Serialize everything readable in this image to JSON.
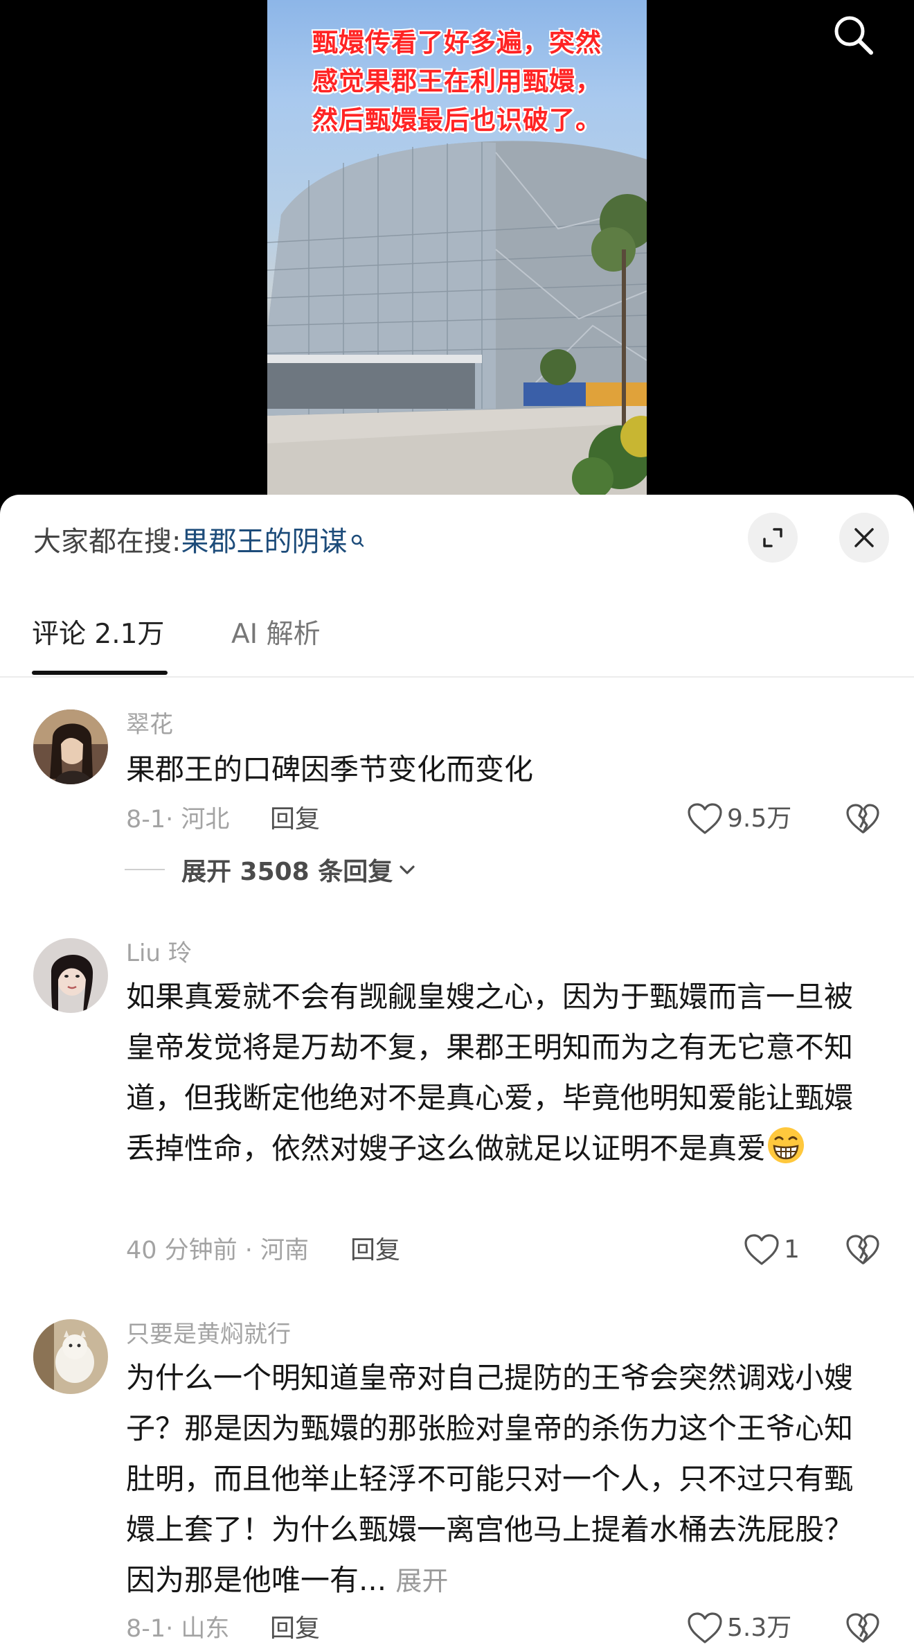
{
  "video": {
    "caption_lines": [
      "甄嬛传看了好多遍，突然",
      "感觉果郡王在利用甄嬛，",
      "然后甄嬛最后也识破了。"
    ]
  },
  "search_bar": {
    "prefix": "大家都在搜:",
    "term": "果郡王的阴谋"
  },
  "tabs": [
    {
      "label": "评论 2.1万",
      "active": true
    },
    {
      "label": "AI 解析",
      "active": false
    }
  ],
  "comments": [
    {
      "author": "翠花",
      "text": "果郡王的口碑因季节变化而变化",
      "meta": "8-1· 河北",
      "reply_label": "回复",
      "likes": "9.5万",
      "expand_replies": "展开 3508 条回复"
    },
    {
      "author": "Liu 玲",
      "text": "如果真爱就不会有觊觎皇嫂之心，因为于甄嬛而言一旦被皇帝发觉将是万劫不复，果郡王明知而为之有无它意不知道，但我断定他绝对不是真心爱，毕竟他明知爱能让甄嬛丢掉性命，依然对嫂子这么做就足以证明不是真爱",
      "emoji": "grinning-face",
      "meta": "40 分钟前 · 河南",
      "reply_label": "回复",
      "likes": "1"
    },
    {
      "author": "只要是黄焖就行",
      "text": "为什么一个明知道皇帝对自己提防的王爷会突然调戏小嫂子？那是因为甄嬛的那张脸对皇帝的杀伤力这个王爷心知肚明，而且他举止轻浮不可能只对一个人，只不过只有甄嬛上套了！为什么甄嬛一离宫他马上提着水桶去洗屁股？因为那是他唯一有...",
      "more_label": "展开",
      "meta": "8-1· 山东",
      "reply_label": "回复",
      "likes": "5.3万"
    }
  ],
  "colors": {
    "caption": "#ff2424",
    "search_term": "#1d4c7a",
    "meta_gray": "#a3a3a3",
    "sheet_bg": "#ffffff",
    "video_bg": "#000000"
  },
  "icons": [
    "search-icon",
    "search-small-icon",
    "expand-icon",
    "close-icon",
    "heart-icon",
    "broken-heart-icon",
    "chevron-down-icon"
  ]
}
